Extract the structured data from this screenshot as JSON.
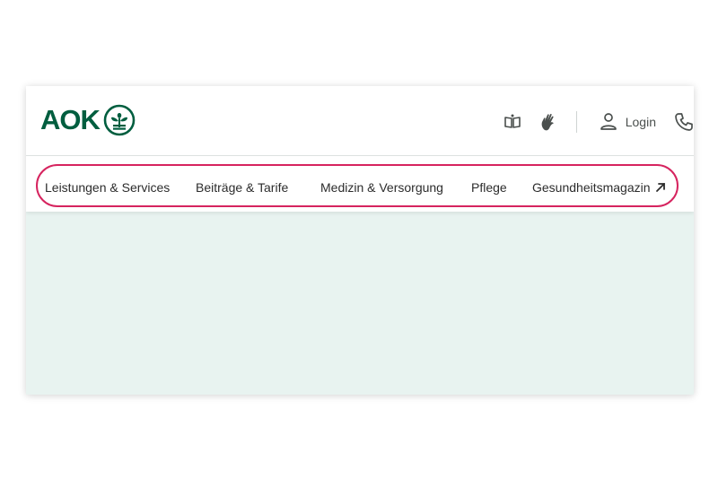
{
  "brand": {
    "name": "AOK",
    "color": "#005e3f"
  },
  "utility": {
    "icons": [
      "book-icon",
      "sign-language-icon",
      "user-icon",
      "phone-icon"
    ],
    "login_label": "Login"
  },
  "nav": {
    "highlight_color": "#d6245f",
    "items": [
      {
        "label": "Leistungen & Services"
      },
      {
        "label": "Beiträge & Tarife"
      },
      {
        "label": "Medizin & Versorgung"
      },
      {
        "label": "Pflege"
      },
      {
        "label": "Gesundheitsmagazin",
        "icon": "external-arrow-icon"
      }
    ]
  },
  "content": {
    "background_color": "#e8f3f0"
  }
}
